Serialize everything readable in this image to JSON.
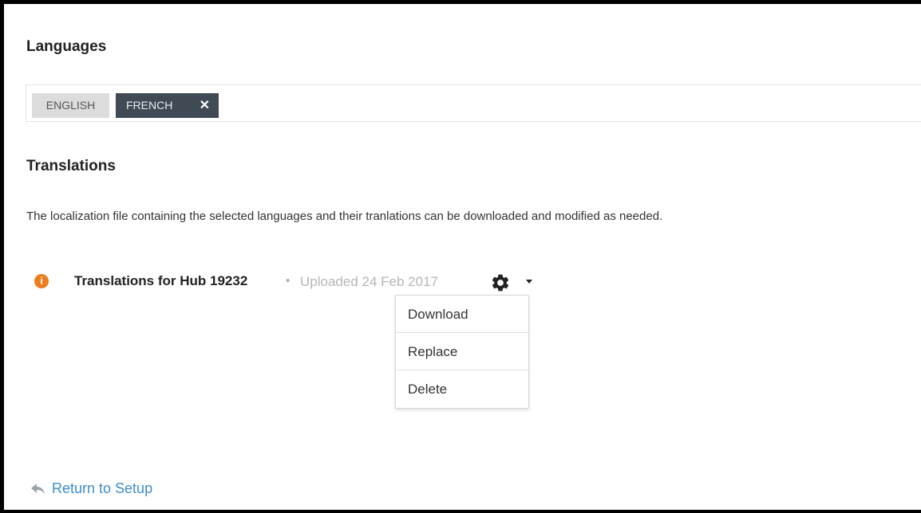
{
  "languages": {
    "title": "Languages",
    "tags": [
      {
        "label": "ENGLISH",
        "removable": false
      },
      {
        "label": "FRENCH",
        "removable": true,
        "remove_glyph": "✕"
      }
    ]
  },
  "translations": {
    "title": "Translations",
    "description": "The localization file containing the selected languages and their tranlations can be downloaded and modified as needed.",
    "file": {
      "status_icon": "info-icon",
      "status_glyph": "i",
      "name": "Translations for Hub 19232",
      "separator": "•",
      "uploaded": "Uploaded 24 Feb 2017"
    },
    "actions_menu": {
      "icon": "gear-icon",
      "items": [
        "Download",
        "Replace",
        "Delete"
      ]
    }
  },
  "footer": {
    "return_label": "Return to Setup",
    "return_icon": "reply-arrow-icon"
  },
  "colors": {
    "accent_link": "#3c8dcf",
    "status_orange": "#f07c1b",
    "selected_tag_bg": "#3f4a54",
    "unselected_tag_bg": "#dcdcdc"
  }
}
